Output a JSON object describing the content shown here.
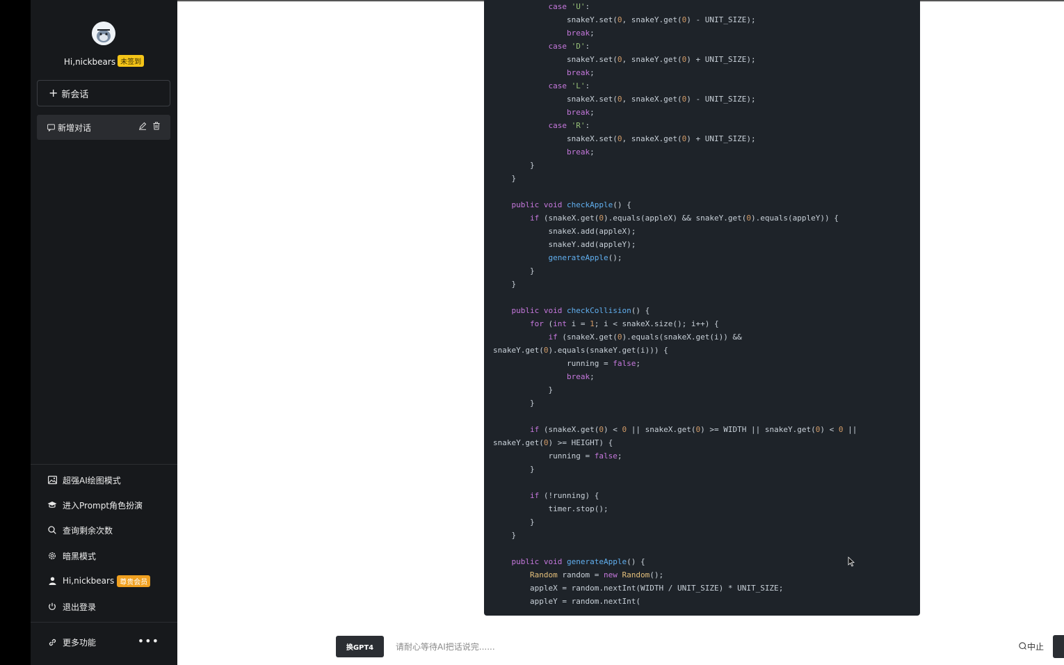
{
  "sidebar": {
    "user_greeting": "Hi,nickbears",
    "checkin_badge": "未签到",
    "new_chat_label": "新会话",
    "conversations": [
      {
        "title": "新增对话"
      }
    ],
    "menu": [
      {
        "label": "超强AI绘图模式",
        "icon": "image-icon"
      },
      {
        "label": "进入Prompt角色扮演",
        "icon": "graduation-cap-icon"
      },
      {
        "label": "查询剩余次数",
        "icon": "search-icon"
      },
      {
        "label": "暗黑模式",
        "icon": "gear-icon"
      },
      {
        "label": "Hi,nickbears",
        "icon": "user-icon",
        "badge": "尊贵会员"
      },
      {
        "label": "退出登录",
        "icon": "power-icon"
      }
    ],
    "more_label": "更多功能",
    "more_dots": "•••"
  },
  "composer": {
    "model_button": "换GPT4",
    "placeholder": "请耐心等待AI把话说完......",
    "stop_label": "中止"
  },
  "code": {
    "language": "java",
    "lines": [
      "            case 'U':",
      "                snakeY.set(0, snakeY.get(0) - UNIT_SIZE);",
      "                break;",
      "            case 'D':",
      "                snakeY.set(0, snakeY.get(0) + UNIT_SIZE);",
      "                break;",
      "            case 'L':",
      "                snakeX.set(0, snakeX.get(0) - UNIT_SIZE);",
      "                break;",
      "            case 'R':",
      "                snakeX.set(0, snakeX.get(0) + UNIT_SIZE);",
      "                break;",
      "        }",
      "    }",
      "",
      "    public void checkApple() {",
      "        if (snakeX.get(0).equals(appleX) && snakeY.get(0).equals(appleY)) {",
      "            snakeX.add(appleX);",
      "            snakeY.add(appleY);",
      "            generateApple();",
      "        }",
      "    }",
      "",
      "    public void checkCollision() {",
      "        for (int i = 1; i < snakeX.size(); i++) {",
      "            if (snakeX.get(0).equals(snakeX.get(i)) &&",
      "snakeY.get(0).equals(snakeY.get(i))) {",
      "                running = false;",
      "                break;",
      "            }",
      "        }",
      "",
      "        if (snakeX.get(0) < 0 || snakeX.get(0) >= WIDTH || snakeY.get(0) < 0 ||",
      "snakeY.get(0) >= HEIGHT) {",
      "            running = false;",
      "        }",
      "",
      "        if (!running) {",
      "            timer.stop();",
      "        }",
      "    }",
      "",
      "    public void generateApple() {",
      "        Random random = new Random();",
      "        appleX = random.nextInt(WIDTH / UNIT_SIZE) * UNIT_SIZE;",
      "        appleY = random.nextInt("
    ]
  },
  "colors": {
    "sidebar_bg": "#17191c",
    "code_bg": "#1e2329",
    "badge_yellow": "#f5c518",
    "badge_orange": "#f0a020"
  }
}
